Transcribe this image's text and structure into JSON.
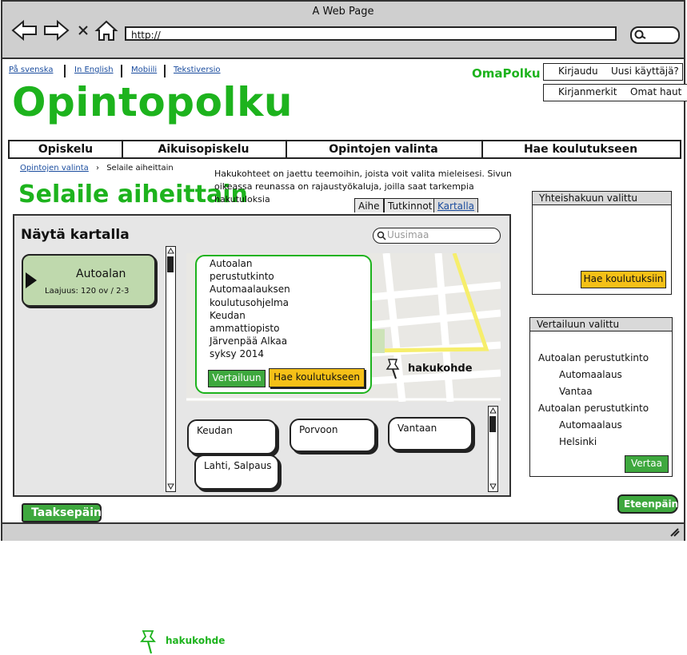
{
  "browser": {
    "window_title": "A Web Page",
    "url": "http://"
  },
  "header": {
    "lang_links": [
      "På svenska",
      "In English",
      "Mobiili",
      "Tekstiversio"
    ],
    "brand": "Opintopolku",
    "omapolku": "OmaPolku",
    "login": "Kirjaudu",
    "new_user": "Uusi käyttäjä?",
    "bookmarks": "Kirjanmerkit",
    "my_searches": "Omat haut"
  },
  "nav": {
    "items": [
      "Opiskelu",
      "Aikuisopiskelu",
      "Opintojen valinta",
      "Hae koulutukseen"
    ]
  },
  "breadcrumb": {
    "link": "Opintojen valinta",
    "current": "Selaile aiheittain"
  },
  "page": {
    "title": "Selaile aiheittain",
    "intro": "Hakukohteet on jaettu teemoihin, joista voit valita mieleisesi. Sivun oikeassa reunassa on rajaustyökaluja, joilla saat tarkempia hakutuloksia"
  },
  "tabs": [
    "Aihe",
    "Tutkinnot",
    "Kartalla"
  ],
  "map_panel": {
    "title": "Näytä kartalla",
    "search_placeholder": "Uusimaa",
    "topic": {
      "title": "Autoalan",
      "scope": "Laajuus: 120 ov / 2-3"
    },
    "info_lines": [
      "Autoalan",
      "perustutkinto",
      "Automaalauksen",
      "koulutusohjelma",
      "Keudan",
      "ammattiopisto",
      "Järvenpää Alkaa",
      "syksy 2014"
    ],
    "compare_btn": "Vertailuun",
    "apply_btn": "Hae koulutukseen",
    "pin_label": "hakukohde",
    "places": [
      "Keudan",
      "Porvoon",
      "Vantaan",
      "Lahti, Salpaus"
    ]
  },
  "sidebar": {
    "joint_title": "Yhteishakuun valittu",
    "joint_btn": "Hae koulutuksiin",
    "compare_title": "Vertailuun valittu",
    "compare_items": [
      {
        "name": "Autoalan perustutkinto",
        "sub1": "Automaalaus",
        "sub2": "Vantaa"
      },
      {
        "name": "Autoalan perustutkinto",
        "sub1": "Automaalaus",
        "sub2": "Helsinki"
      }
    ],
    "compare_btn": "Vertaa"
  },
  "footer_nav": {
    "back": "Taaksepäin",
    "forward": "Eteenpäin"
  },
  "legend": {
    "label": "hakukohde"
  },
  "colors": {
    "brand_green": "#1db31d",
    "button_green": "#3ea83e",
    "button_yellow": "#f5c017",
    "link_blue": "#1a4c9e"
  }
}
